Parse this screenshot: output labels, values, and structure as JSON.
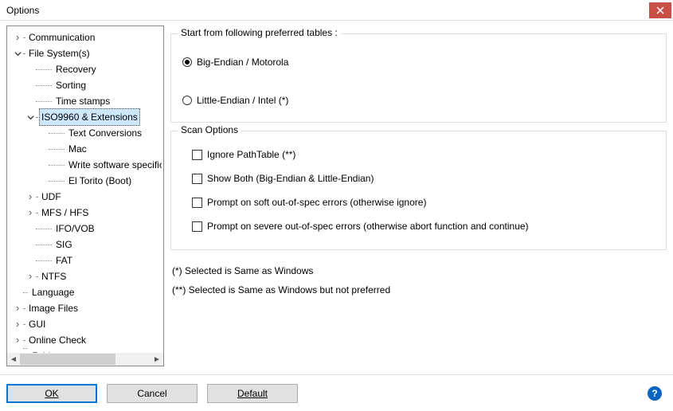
{
  "window": {
    "title": "Options"
  },
  "tree": {
    "items": [
      {
        "label": "Communication",
        "indent": 0,
        "expander": "collapsed",
        "dot": 6
      },
      {
        "label": "File System(s)",
        "indent": 0,
        "expander": "expanded",
        "dot": 6
      },
      {
        "label": "Recovery",
        "indent": 1,
        "expander": "none",
        "dot": 20
      },
      {
        "label": "Sorting",
        "indent": 1,
        "expander": "none",
        "dot": 20
      },
      {
        "label": "Time stamps",
        "indent": 1,
        "expander": "none",
        "dot": 20
      },
      {
        "label": "ISO9960 & Extensions",
        "indent": 1,
        "expander": "expanded",
        "dot": 6,
        "selected": true
      },
      {
        "label": "Text Conversions",
        "indent": 2,
        "expander": "none",
        "dot": 20
      },
      {
        "label": "Mac",
        "indent": 2,
        "expander": "none",
        "dot": 20
      },
      {
        "label": "Write software specific",
        "indent": 2,
        "expander": "none",
        "dot": 20,
        "cut": true
      },
      {
        "label": "El Torito (Boot)",
        "indent": 2,
        "expander": "none",
        "dot": 20
      },
      {
        "label": "UDF",
        "indent": 1,
        "expander": "collapsed",
        "dot": 6
      },
      {
        "label": "MFS / HFS",
        "indent": 1,
        "expander": "collapsed",
        "dot": 6
      },
      {
        "label": "IFO/VOB",
        "indent": 1,
        "expander": "none",
        "dot": 20
      },
      {
        "label": "SIG",
        "indent": 1,
        "expander": "none",
        "dot": 20
      },
      {
        "label": "FAT",
        "indent": 1,
        "expander": "none",
        "dot": 20
      },
      {
        "label": "NTFS",
        "indent": 1,
        "expander": "collapsed",
        "dot": 6
      },
      {
        "label": "Language",
        "indent": 0,
        "expander": "none",
        "dot": 6
      },
      {
        "label": "Image Files",
        "indent": 0,
        "expander": "collapsed",
        "dot": 6
      },
      {
        "label": "GUI",
        "indent": 0,
        "expander": "collapsed",
        "dot": 6
      },
      {
        "label": "Online Check",
        "indent": 0,
        "expander": "collapsed",
        "dot": 6
      },
      {
        "label": "Folders",
        "indent": 0,
        "expander": "none",
        "dot": 6,
        "partial": true
      }
    ]
  },
  "preferred": {
    "legend": "Start from following preferred tables :",
    "big_endian": "Big-Endian / Motorola",
    "little_endian": "Little-Endian / Intel  (*)"
  },
  "scan": {
    "legend": "Scan Options",
    "ignore_pathtable": "Ignore PathTable  (**)",
    "show_both": "Show Both (Big-Endian & Little-Endian)",
    "prompt_soft": "Prompt on soft out-of-spec errors (otherwise ignore)",
    "prompt_severe": "Prompt on severe out-of-spec errors (otherwise abort function and continue)"
  },
  "notes": {
    "n1": "(*)  Selected is Same as Windows",
    "n2": "(**) Selected is Same as Windows but not preferred"
  },
  "buttons": {
    "ok": "OK",
    "cancel": "Cancel",
    "default": "Default"
  }
}
